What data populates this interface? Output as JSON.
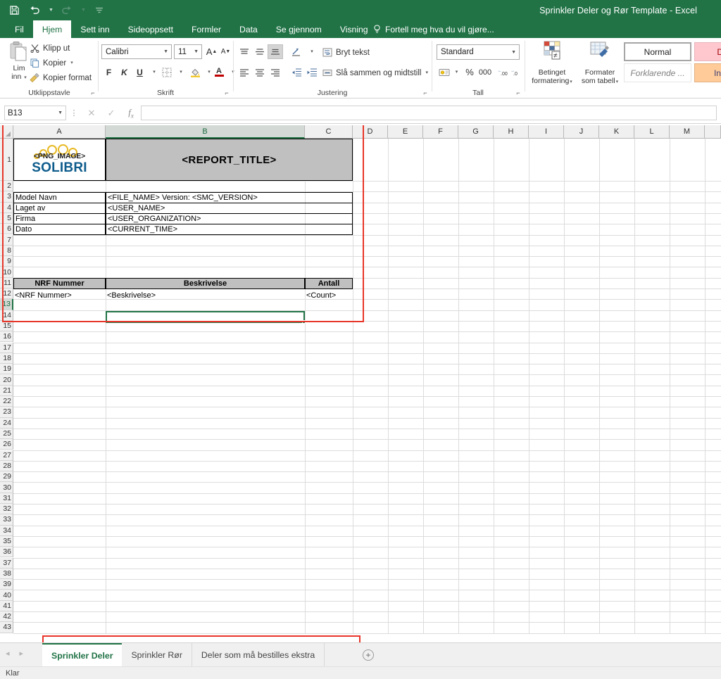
{
  "window": {
    "title": "Sprinkler Deler og Rør Template - Excel",
    "quick_access": [
      {
        "name": "save-icon",
        "label": "Lagre"
      },
      {
        "name": "undo-icon",
        "label": "Angre"
      },
      {
        "name": "redo-icon",
        "label": "Gjør om"
      },
      {
        "name": "customize-qat-icon",
        "label": "Tilpass verktøylinje for hurtigtilgang"
      }
    ]
  },
  "ribbon": {
    "tabs": [
      {
        "label": "Fil",
        "active": false
      },
      {
        "label": "Hjem",
        "active": true
      },
      {
        "label": "Sett inn",
        "active": false
      },
      {
        "label": "Sideoppsett",
        "active": false
      },
      {
        "label": "Formler",
        "active": false
      },
      {
        "label": "Data",
        "active": false
      },
      {
        "label": "Se gjennom",
        "active": false
      },
      {
        "label": "Visning",
        "active": false
      }
    ],
    "tell_me": "Fortell meg hva du vil gjøre...",
    "groups": {
      "clipboard": {
        "label": "Utklippstavle",
        "paste": "Lim\ninn",
        "paste_line1": "Lim",
        "paste_line2": "inn",
        "cut": "Klipp ut",
        "copy": "Kopier",
        "format_painter": "Kopier format"
      },
      "font": {
        "label": "Skrift",
        "font_name": "Calibri",
        "font_size": "11",
        "bold": "F",
        "italic": "K",
        "underline": "U",
        "grow": "A",
        "shrink": "A",
        "borders_icon": "borders-icon",
        "fill_icon": "fill-color-icon",
        "font_color": "A"
      },
      "alignment": {
        "label": "Justering",
        "wrap_text": "Bryt tekst",
        "merge_center": "Slå sammen og midtstill"
      },
      "number": {
        "label": "Tall",
        "format": "Standard",
        "percent": "%",
        "thousands": "000",
        "accounting_icon": "accounting-format-icon",
        "decrease_decimal": "decrease-decimal-icon",
        "increase_decimal": "increase-decimal-icon"
      },
      "styles": {
        "conditional_formatting_line1": "Betinget",
        "conditional_formatting_line2": "formatering",
        "format_as_table_line1": "Formater",
        "format_as_table_line2": "som tabell",
        "cell_styles": [
          "Normal",
          "Dårlig",
          "Forklarende ...",
          "Inndata"
        ]
      }
    }
  },
  "formula_bar": {
    "name_box": "B13",
    "cancel_icon": "cancel-icon",
    "confirm_icon": "confirm-icon",
    "function_icon": "insert-function-icon",
    "value": ""
  },
  "grid": {
    "columns": [
      "A",
      "B",
      "C",
      "D",
      "E",
      "F",
      "G",
      "H",
      "I",
      "J",
      "K",
      "L",
      "M"
    ],
    "active_cell": "B13",
    "active_column": "B",
    "active_row": 13,
    "first_row": 1,
    "last_row": 43,
    "cells": {
      "a1_logo_png_text": "<PNG_IMAGE>",
      "a1_logo_word": "SOLIBRI",
      "b1_report_title": "<REPORT_TITLE>",
      "a3": "Model Navn",
      "b3": "<FILE_NAME> Version: <SMC_VERSION>",
      "a4": "Laget av",
      "b4": "<USER_NAME>",
      "a5": "Firma",
      "b5": "<USER_ORGANIZATION>",
      "a6": "Dato",
      "b6": "<CURRENT_TIME>",
      "a10": "NRF Nummer",
      "b10": "Beskrivelse",
      "c10": "Antall",
      "a11": "<NRF Nummer>",
      "b11": "<Beskrivelse>",
      "c11": "<Count>"
    }
  },
  "sheet_tabs": {
    "tabs": [
      {
        "label": "Sprinkler Deler",
        "active": true
      },
      {
        "label": "Sprinkler Rør",
        "active": false
      },
      {
        "label": "Deler som må bestilles ekstra",
        "active": false
      }
    ],
    "add_sheet": "+",
    "nav_prev": "◂",
    "nav_next": "▸"
  },
  "status_bar": {
    "mode": "Klar"
  },
  "colors": {
    "excel_green": "#217346",
    "annotation_red": "#e8352a",
    "header_gray": "#c0c0c0",
    "logo_gold": "#e8b923",
    "logo_blue": "#0d5c8c"
  }
}
